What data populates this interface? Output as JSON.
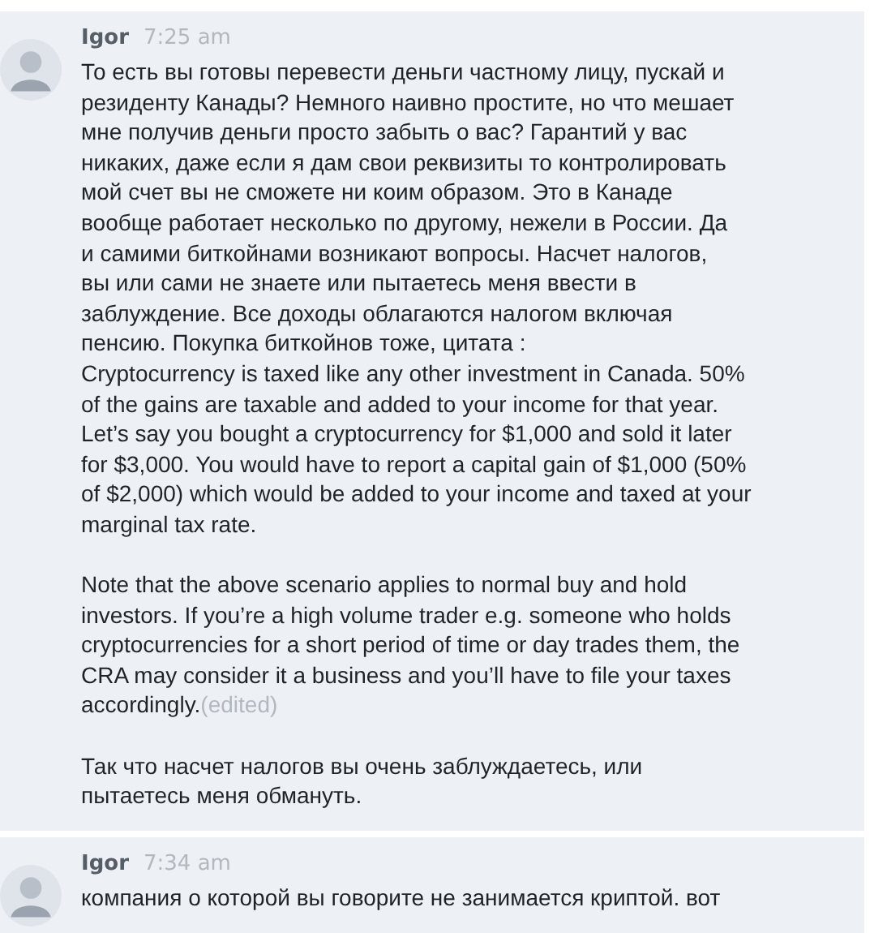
{
  "messages": [
    {
      "author": "Igor",
      "time": "7:25 am",
      "paragraphs": [
        {
          "text": "То есть вы готовы перевести деньги частному лицу, пускай и\nрезиденту Канады? Немного наивно простите, но что мешает\nмне получив деньги просто забыть о вас? Гарантий у вас\nникаких, даже если я дам свои реквизиты то контролировать\nмой счет вы не сможете ни коим образом. Это в Канаде\nвообще работает несколько по другому, нежели в России. Да\nи самими биткойнами возникают вопросы. Насчет налогов,\nвы или сами не знаете или пытаетесь меня ввести в\nзаблуждение. Все доходы облагаются налогом включая\nпенсию. Покупка биткойнов тоже, цитата :\nCryptocurrency is taxed like any other investment in Canada. 50%\nof the gains are taxable and added to your income for that year.\nLet’s say you bought a cryptocurrency for $1,000 and sold it later\nfor $3,000. You would have to report a capital gain of $1,000 (50%\nof $2,000) which would be added to your income and taxed at your\nmarginal tax rate."
        },
        {
          "text": "Note that the above scenario applies to normal buy and hold\ninvestors. If you’re a high volume trader e.g. someone who holds\ncryptocurrencies for a short period of time or day trades them, the\nCRA may consider it a business and you’ll have to file your taxes\naccordingly.",
          "edited": "(edited)"
        },
        {
          "text": "Так что насчет налогов вы очень заблуждаетесь, или\nпытаетесь меня обмануть."
        }
      ]
    },
    {
      "author": "Igor",
      "time": "7:34 am",
      "paragraphs": [
        {
          "text": "компания о которой вы говорите не занимается криптой. вот"
        }
      ]
    }
  ]
}
